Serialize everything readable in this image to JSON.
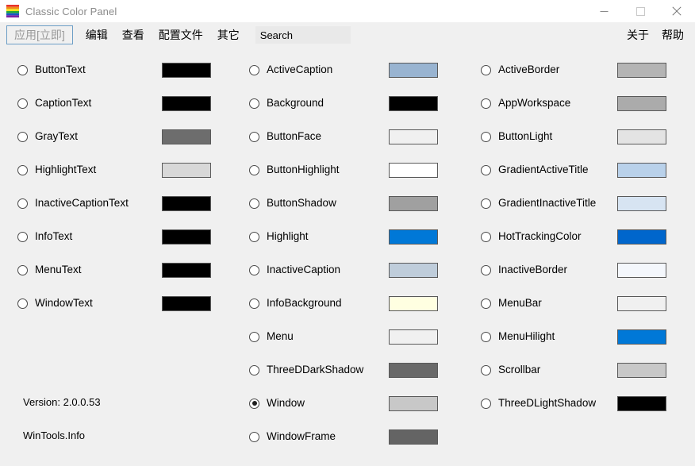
{
  "window": {
    "title": "Classic Color Panel",
    "icon": "rainbow-palette-icon",
    "minimize_label": "Minimize",
    "maximize_label": "Maximize",
    "close_label": "Close"
  },
  "menubar": {
    "apply_label": "应用[立即]",
    "items": [
      {
        "label": "编辑"
      },
      {
        "label": "查看"
      },
      {
        "label": "配置文件"
      },
      {
        "label": "其它"
      }
    ],
    "search": {
      "value": "Search",
      "placeholder": "Search"
    },
    "right_items": [
      {
        "label": "关于"
      },
      {
        "label": "帮助"
      }
    ]
  },
  "colors": {
    "window_bg": "#f0f0f0",
    "titlebar_bg": "#ffffff",
    "accent_highlight": "#0078d7",
    "focus_border": "#6d9ec6",
    "swatch_border": "#5a5a5a"
  },
  "columns": [
    {
      "name": "column-1",
      "items": [
        {
          "label": "ButtonText",
          "color": "#000000",
          "selected": false
        },
        {
          "label": "CaptionText",
          "color": "#000000",
          "selected": false
        },
        {
          "label": "GrayText",
          "color": "#6d6d6d",
          "selected": false
        },
        {
          "label": "HighlightText",
          "color": "#d8d8d8",
          "selected": false
        },
        {
          "label": "InactiveCaptionText",
          "color": "#000000",
          "selected": false
        },
        {
          "label": "InfoText",
          "color": "#000000",
          "selected": false
        },
        {
          "label": "MenuText",
          "color": "#000000",
          "selected": false
        },
        {
          "label": "WindowText",
          "color": "#000000",
          "selected": false
        }
      ]
    },
    {
      "name": "column-2",
      "items": [
        {
          "label": "ActiveCaption",
          "color": "#99b4d1",
          "selected": false
        },
        {
          "label": "Background",
          "color": "#000000",
          "selected": false
        },
        {
          "label": "ButtonFace",
          "color": "#f0f0f0",
          "selected": false
        },
        {
          "label": "ButtonHighlight",
          "color": "#ffffff",
          "selected": false
        },
        {
          "label": "ButtonShadow",
          "color": "#a0a0a0",
          "selected": false
        },
        {
          "label": "Highlight",
          "color": "#0078d7",
          "selected": false
        },
        {
          "label": "InactiveCaption",
          "color": "#bfcddb",
          "selected": false
        },
        {
          "label": "InfoBackground",
          "color": "#ffffe1",
          "selected": false
        },
        {
          "label": "Menu",
          "color": "#f0f0f0",
          "selected": false
        },
        {
          "label": "ThreeDDarkShadow",
          "color": "#696969",
          "selected": false
        },
        {
          "label": "Window",
          "color": "#c8c8c8",
          "selected": true
        },
        {
          "label": "WindowFrame",
          "color": "#646464",
          "selected": false
        }
      ]
    },
    {
      "name": "column-3",
      "items": [
        {
          "label": "ActiveBorder",
          "color": "#b4b4b4",
          "selected": false
        },
        {
          "label": "AppWorkspace",
          "color": "#ababab",
          "selected": false
        },
        {
          "label": "ButtonLight",
          "color": "#e3e3e3",
          "selected": false
        },
        {
          "label": "GradientActiveTitle",
          "color": "#b9d1ea",
          "selected": false
        },
        {
          "label": "GradientInactiveTitle",
          "color": "#d7e4f2",
          "selected": false
        },
        {
          "label": "HotTrackingColor",
          "color": "#0066cc",
          "selected": false
        },
        {
          "label": "InactiveBorder",
          "color": "#f4f7fc",
          "selected": false
        },
        {
          "label": "MenuBar",
          "color": "#f0f0f0",
          "selected": false
        },
        {
          "label": "MenuHilight",
          "color": "#0078d7",
          "selected": false
        },
        {
          "label": "Scrollbar",
          "color": "#c8c8c8",
          "selected": false
        },
        {
          "label": "ThreeDLightShadow",
          "color": "#000000",
          "selected": false
        }
      ]
    }
  ],
  "footer": {
    "version": "Version: 2.0.0.53",
    "site": "WinTools.Info"
  }
}
